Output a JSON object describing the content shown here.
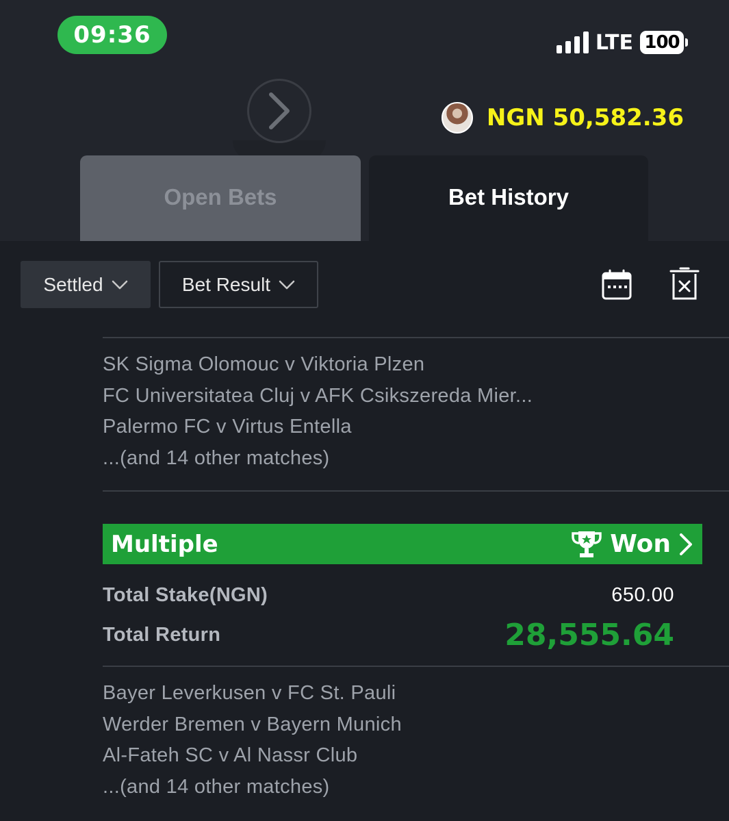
{
  "status_bar": {
    "time": "09:36",
    "network": "LTE",
    "battery": "100"
  },
  "header": {
    "balance": "NGN 50,582.36",
    "nav_icon": "chevron-right-icon",
    "avatar_icon": "avatar"
  },
  "tabs": [
    {
      "label": "Open Bets",
      "active": false
    },
    {
      "label": "Bet History",
      "active": true
    }
  ],
  "filters": {
    "status": "Settled",
    "result": "Bet Result",
    "calendar_icon": "calendar-icon",
    "clear_icon": "clear-filter-icon"
  },
  "bets": [
    {
      "matches": [
        "SK Sigma Olomouc v Viktoria Plzen",
        "FC Universitatea Cluj v AFK Csikszereda Mier...",
        "Palermo FC v Virtus Entella",
        "...(and 14 other matches)"
      ]
    },
    {
      "type": "Multiple",
      "status": "Won",
      "stake_label": "Total Stake(NGN)",
      "stake_value": "650.00",
      "return_label": "Total Return",
      "return_value": "28,555.64",
      "matches": [
        "Bayer Leverkusen v FC St. Pauli",
        "Werder Bremen v Bayern Munich",
        "Al-Fateh SC v Al Nassr Club",
        "...(and 14 other matches)"
      ]
    }
  ],
  "colors": {
    "background": "#1b1e24",
    "accent_green": "#1fa038",
    "balance_yellow": "#f6f219",
    "time_pill": "#2fb84f"
  }
}
